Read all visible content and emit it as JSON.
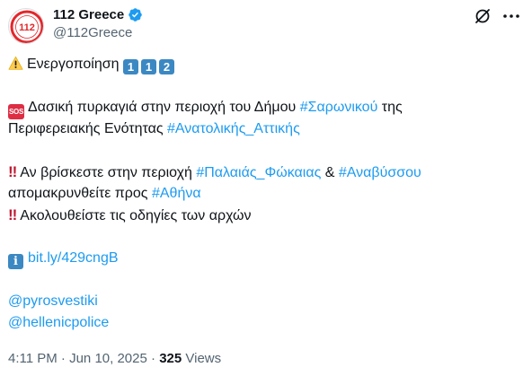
{
  "author": {
    "display_name": "112 Greece",
    "handle": "@112Greece",
    "avatar_text": "112"
  },
  "post": {
    "line1": {
      "text": "Ενεργοποίηση",
      "emoji": "warning-icon",
      "keycaps": [
        "1",
        "1",
        "2"
      ]
    },
    "line2": {
      "text_before": "Δασική πυρκαγιά στην περιοχή του Δήμου ",
      "link": "#Σαρωνικού",
      "text_after": " της",
      "emoji": "sos-icon",
      "sos_label": "SOS"
    },
    "line3": {
      "text_before": "Περιφερειακής Ενότητας ",
      "link": "#Ανατολικής_Αττικής"
    },
    "line4": {
      "text_before": "Αν βρίσκεστε στην περιοχή ",
      "link1": "#Παλαιάς_Φώκαιας",
      "middle": " & ",
      "link2": "#Αναβύσσου",
      "emoji": "double-exclamation-icon",
      "bang": "‼"
    },
    "line5": {
      "text_before": "απομακρυνθείτε προς ",
      "link": "#Αθήνα"
    },
    "line6": {
      "text": "Ακολουθείστε τις οδηγίες των αρχών",
      "emoji": "double-exclamation-icon",
      "bang": "‼"
    },
    "line7": {
      "link": "bit.ly/429cngB",
      "emoji": "information-icon",
      "info_label": "i"
    },
    "line8": {
      "link": "@pyrosvestiki"
    },
    "line9": {
      "link": "@hellenicpolice"
    }
  },
  "meta": {
    "time": "4:11 PM",
    "separator": " · ",
    "date": "Jun 10, 2025",
    "views_count": "325",
    "views_label": " Views"
  },
  "colors": {
    "link": "#1d9bf0",
    "text": "#0f1419",
    "muted": "#536471",
    "brand_red": "#e3262b"
  }
}
